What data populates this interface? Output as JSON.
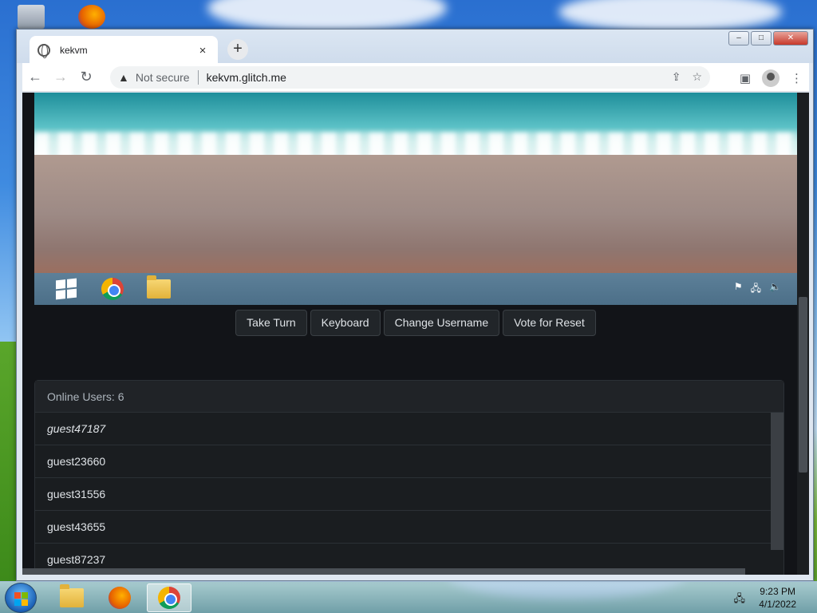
{
  "browser": {
    "tab_title": "kekvm",
    "tab_close": "×",
    "new_tab": "+",
    "security_label": "Not secure",
    "url": "kekvm.glitch.me",
    "window_controls": {
      "minimize": "–",
      "maximize": "□",
      "close": "✕"
    }
  },
  "icons": {
    "back": "←",
    "forward": "→",
    "reload": "↻",
    "warning": "▲",
    "share": "⇪",
    "bookmark": "☆",
    "side_panel": "▣",
    "menu": "⋮"
  },
  "vm": {
    "taskbar_apps": [
      "windows-start",
      "chrome",
      "file-explorer"
    ]
  },
  "controls": {
    "take_turn": "Take Turn",
    "keyboard": "Keyboard",
    "change_username": "Change Username",
    "vote_reset": "Vote for Reset"
  },
  "users": {
    "header": "Online Users: 6",
    "list": [
      "guest47187",
      "guest23660",
      "guest31556",
      "guest43655",
      "guest87237"
    ]
  },
  "host_taskbar": {
    "time": "9:23 PM",
    "date": "4/1/2022"
  },
  "colors": {
    "page_bg": "#121418",
    "button_bg": "#212529",
    "accent_text": "#dee2e6"
  }
}
